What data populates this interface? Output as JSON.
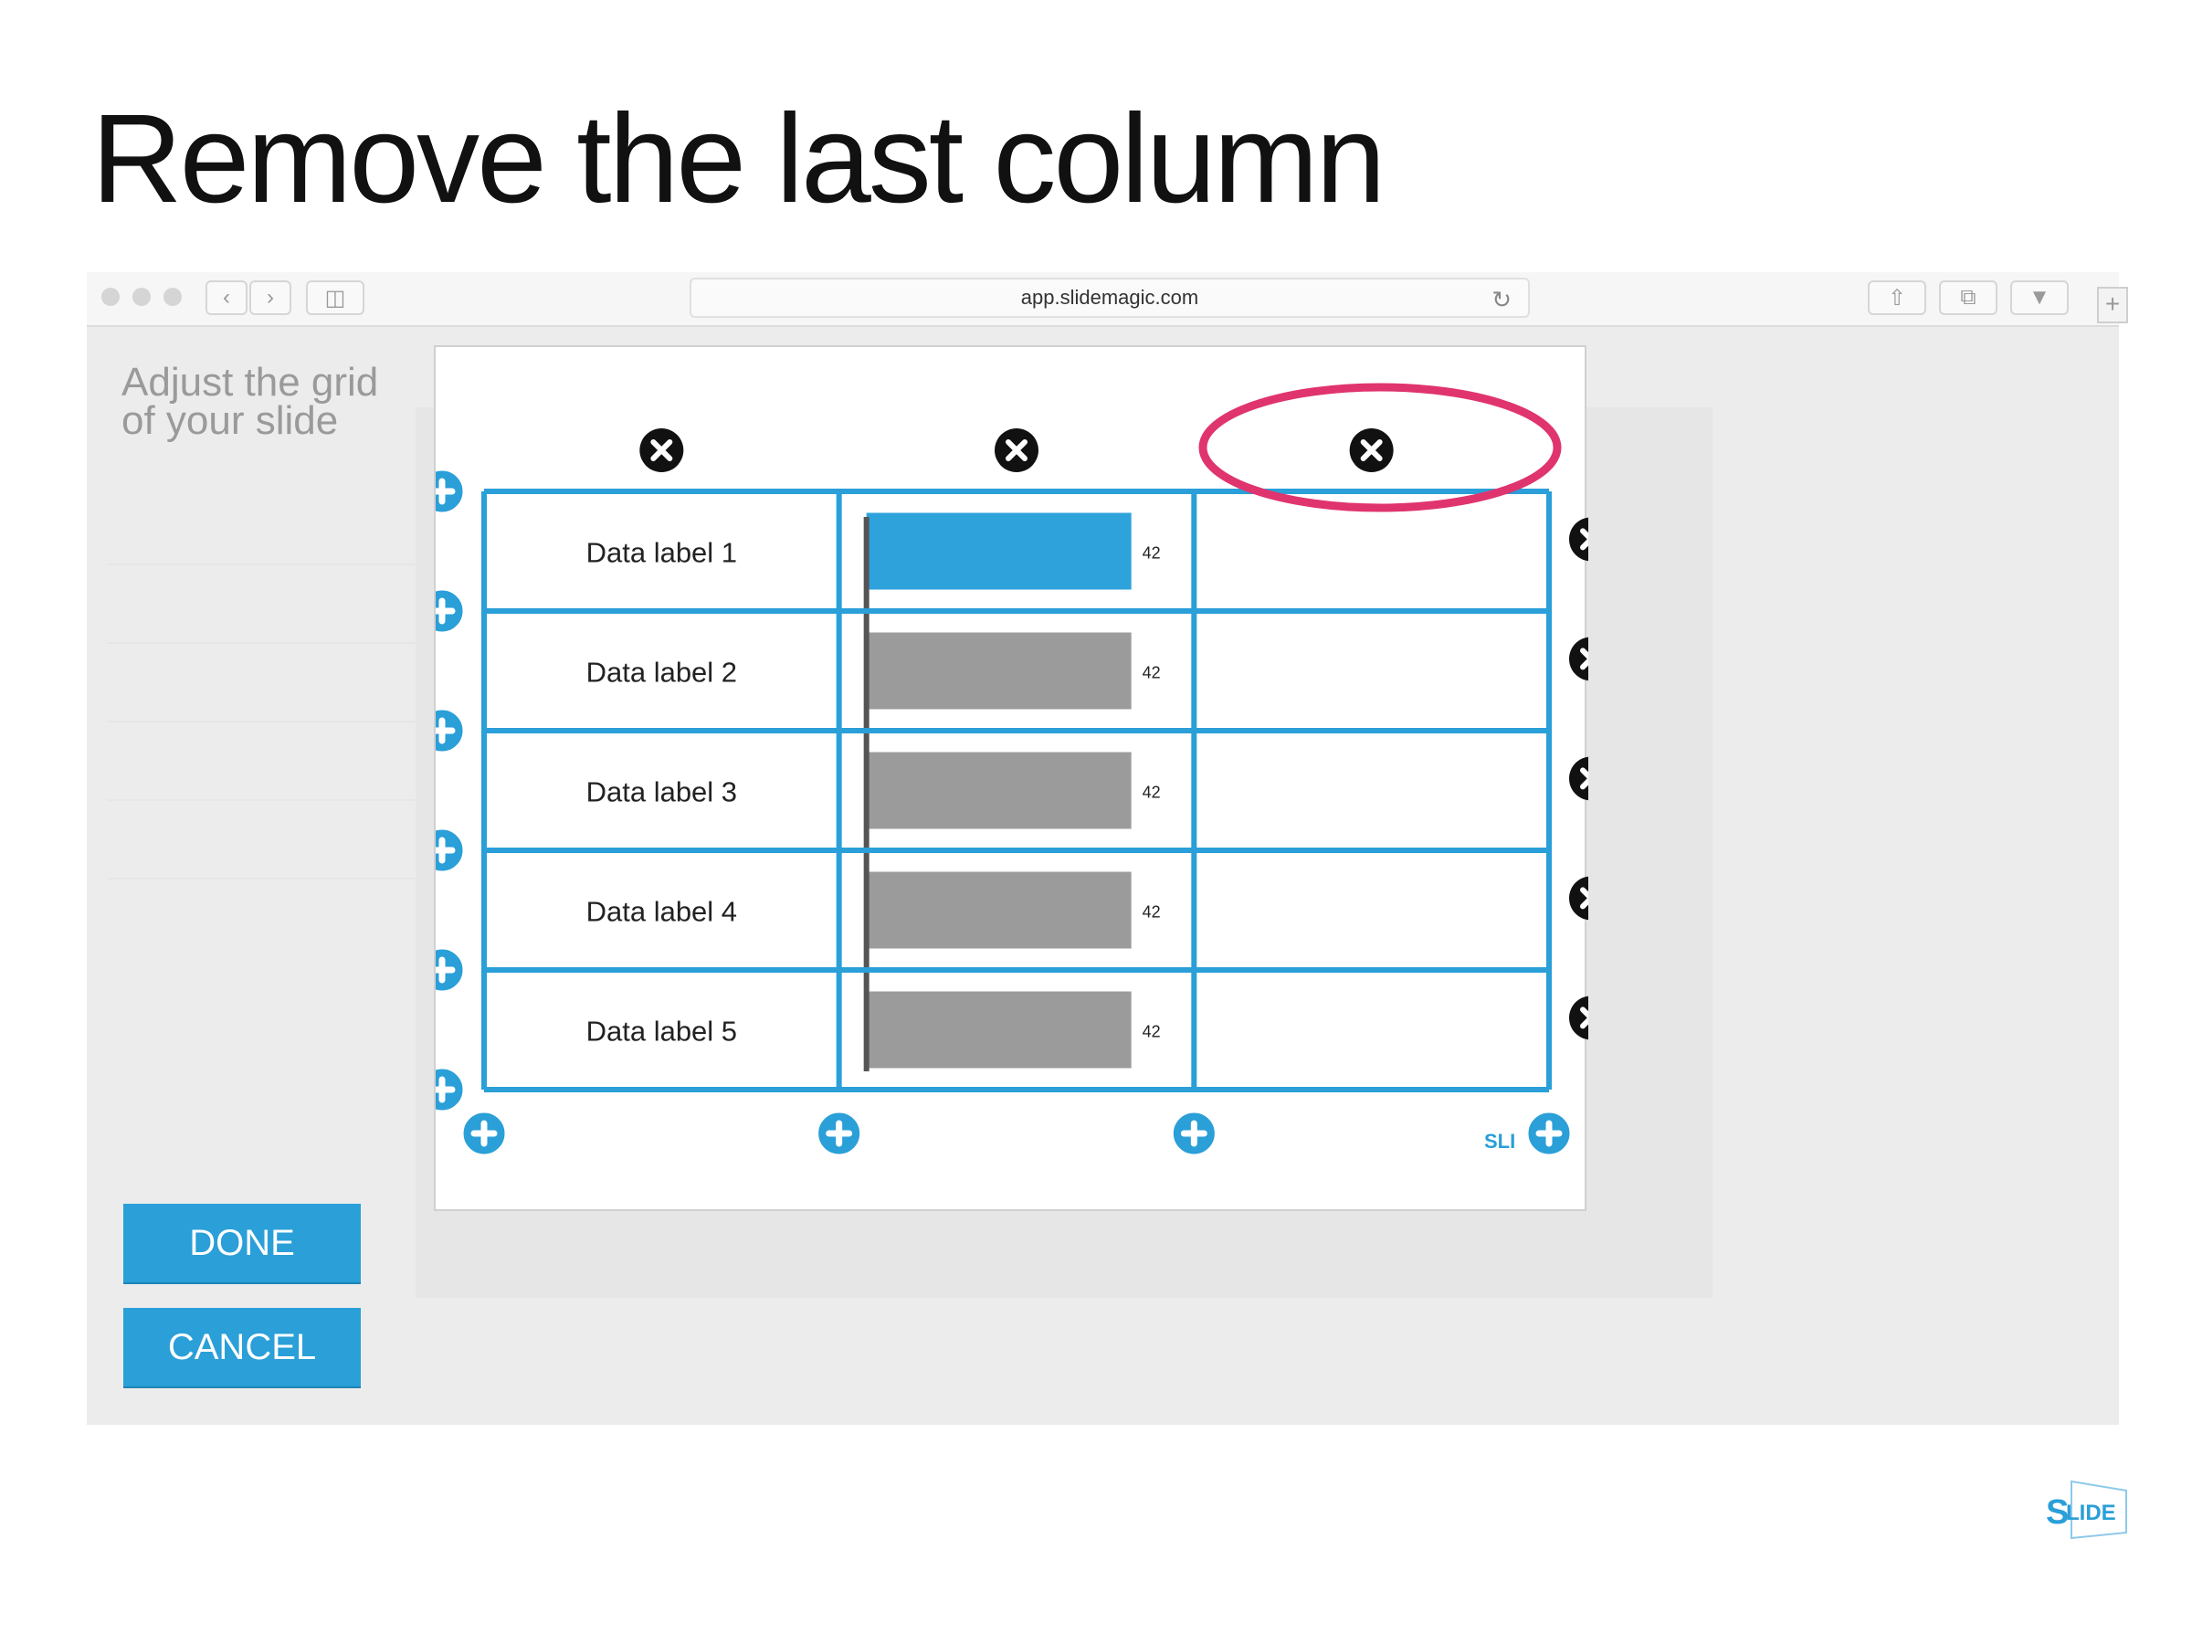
{
  "slide": {
    "title": "Remove the last column"
  },
  "browser": {
    "url": "app.slidemagic.com"
  },
  "app": {
    "sidebar_title_line1": "Adjust the grid",
    "sidebar_title_line2": "of your slide",
    "done_label": "DONE",
    "cancel_label": "CANCEL"
  },
  "grid": {
    "rows": [
      {
        "label": "Data label 1",
        "value": "42",
        "highlight": true
      },
      {
        "label": "Data label 2",
        "value": "42",
        "highlight": false
      },
      {
        "label": "Data label 3",
        "value": "42",
        "highlight": false
      },
      {
        "label": "Data label 4",
        "value": "42",
        "highlight": false
      },
      {
        "label": "Data label 5",
        "value": "42",
        "highlight": false
      }
    ],
    "column_count": 3,
    "accent_color": "#2a9fd8",
    "bar_color": "#9b9b9b",
    "highlight_bar_color": "#2ea2db",
    "annotation_color": "#e0346e"
  },
  "icons": {
    "remove": "close-circle-icon",
    "add": "plus-circle-icon"
  }
}
